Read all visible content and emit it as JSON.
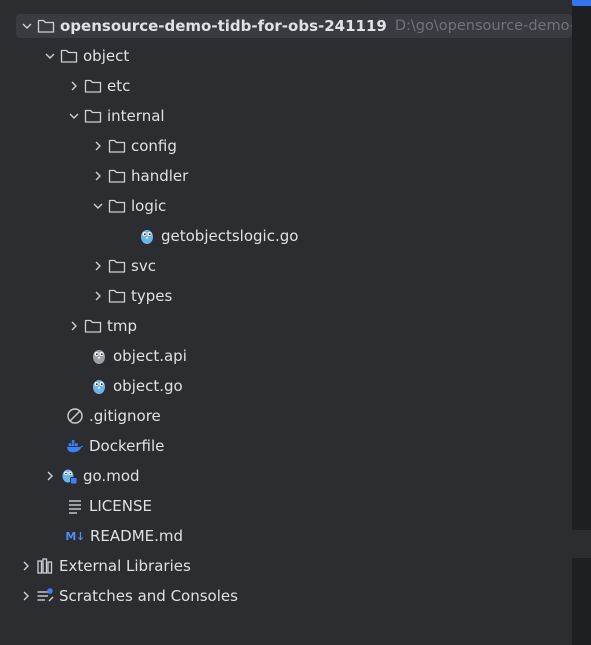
{
  "project": {
    "name": "opensource-demo-tidb-for-obs-241119",
    "path": "D:\\go\\opensource-demo-ti"
  },
  "items": {
    "object": "object",
    "etc": "etc",
    "internal": "internal",
    "config": "config",
    "handler": "handler",
    "logic": "logic",
    "getobjectslogic": "getobjectslogic.go",
    "svc": "svc",
    "types": "types",
    "tmp": "tmp",
    "object_api": "object.api",
    "object_go": "object.go",
    "gitignore": ".gitignore",
    "dockerfile": "Dockerfile",
    "gomod": "go.mod",
    "license": "LICENSE",
    "readme": "README.md",
    "external_libraries": "External Libraries",
    "scratches": "Scratches and Consoles"
  },
  "icons": {
    "markdown_badge": "M↓"
  },
  "colors": {
    "background": "#2b2d30",
    "selection": "#393b40",
    "text": "#dfe1e5",
    "path_text": "#6f737a",
    "folder_outline": "#ced0d6",
    "go_gopher": "#6fb4e8",
    "docker": "#3c82f6",
    "accent": "#3574f0"
  }
}
